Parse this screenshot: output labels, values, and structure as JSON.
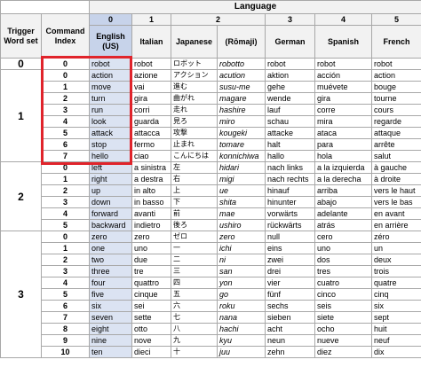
{
  "header": {
    "language_label": "Language",
    "trigger_label": "Trigger Word set",
    "command_label": "Command Index",
    "col_numbers": [
      "0",
      "1",
      "2",
      "3",
      "4",
      "5"
    ],
    "languages": [
      "English (US)",
      "Italian",
      "Japanese",
      "(Rōmaji)",
      "German",
      "Spanish",
      "French"
    ]
  },
  "groups": [
    {
      "set": "0",
      "rows": [
        [
          "0",
          "robot",
          "robot",
          "ロボット",
          "robotto",
          "robot",
          "robot",
          "robot"
        ]
      ]
    },
    {
      "set": "1",
      "rows": [
        [
          "0",
          "action",
          "azione",
          "アクション",
          "acution",
          "aktion",
          "acción",
          "action"
        ],
        [
          "1",
          "move",
          "vai",
          "進む",
          "susu-me",
          "gehe",
          "muévete",
          "bouge"
        ],
        [
          "2",
          "turn",
          "gira",
          "曲がれ",
          "magare",
          "wende",
          "gira",
          "tourne"
        ],
        [
          "3",
          "run",
          "corri",
          "走れ",
          "hashire",
          "lauf",
          "corre",
          "cours"
        ],
        [
          "4",
          "look",
          "guarda",
          "見ろ",
          "miro",
          "schau",
          "mira",
          "regarde"
        ],
        [
          "5",
          "attack",
          "attacca",
          "攻撃",
          "kougeki",
          "attacke",
          "ataca",
          "attaque"
        ],
        [
          "6",
          "stop",
          "fermo",
          "止まれ",
          "tomare",
          "halt",
          "para",
          "arrête"
        ],
        [
          "7",
          "hello",
          "ciao",
          "こんにちは",
          "konnichiwa",
          "hallo",
          "hola",
          "salut"
        ]
      ]
    },
    {
      "set": "2",
      "rows": [
        [
          "0",
          "left",
          "a sinistra",
          "左",
          "hidari",
          "nach links",
          "a la izquierda",
          "à gauche"
        ],
        [
          "1",
          "right",
          "a destra",
          "右",
          "migi",
          "nach rechts",
          "a la derecha",
          "à droite"
        ],
        [
          "2",
          "up",
          "in alto",
          "上",
          "ue",
          "hinauf",
          "arriba",
          "vers le haut"
        ],
        [
          "3",
          "down",
          "in basso",
          "下",
          "shita",
          "hinunter",
          "abajo",
          "vers le bas"
        ],
        [
          "4",
          "forward",
          "avanti",
          "前",
          "mae",
          "vorwärts",
          "adelante",
          "en avant"
        ],
        [
          "5",
          "backward",
          "indietro",
          "後ろ",
          "ushiro",
          "rückwärts",
          "atrás",
          "en arrière"
        ]
      ]
    },
    {
      "set": "3",
      "rows": [
        [
          "0",
          "zero",
          "zero",
          "ゼロ",
          "zero",
          "null",
          "cero",
          "zéro"
        ],
        [
          "1",
          "one",
          "uno",
          "一",
          "ichi",
          "eins",
          "uno",
          "un"
        ],
        [
          "2",
          "two",
          "due",
          "二",
          "ni",
          "zwei",
          "dos",
          "deux"
        ],
        [
          "3",
          "three",
          "tre",
          "三",
          "san",
          "drei",
          "tres",
          "trois"
        ],
        [
          "4",
          "four",
          "quattro",
          "四",
          "yon",
          "vier",
          "cuatro",
          "quatre"
        ],
        [
          "5",
          "five",
          "cinque",
          "五",
          "go",
          "fünf",
          "cinco",
          "cinq"
        ],
        [
          "6",
          "six",
          "sei",
          "六",
          "roku",
          "sechs",
          "seis",
          "six"
        ],
        [
          "7",
          "seven",
          "sette",
          "七",
          "nana",
          "sieben",
          "siete",
          "sept"
        ],
        [
          "8",
          "eight",
          "otto",
          "八",
          "hachi",
          "acht",
          "ocho",
          "huit"
        ],
        [
          "9",
          "nine",
          "nove",
          "九",
          "kyu",
          "neun",
          "nueve",
          "neuf"
        ],
        [
          "10",
          "ten",
          "dieci",
          "十",
          "juu",
          "zehn",
          "diez",
          "dix"
        ]
      ]
    }
  ],
  "highlight_color": "#e0242b",
  "english_column_color": "#dbe3f2"
}
